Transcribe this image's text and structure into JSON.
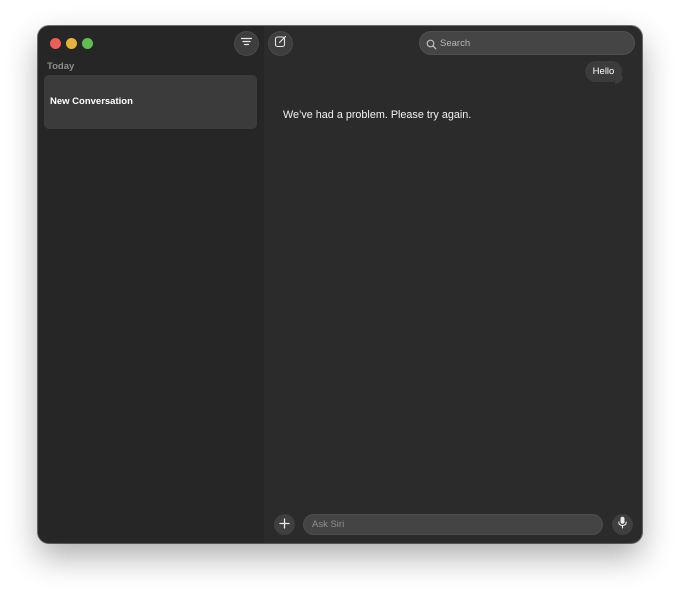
{
  "window": {
    "controls": [
      "close",
      "minimize",
      "zoom"
    ],
    "colors": {
      "close": "#ec5f57",
      "minimize": "#e3b33d",
      "zoom": "#5fbe4f"
    }
  },
  "toolbar": {
    "filter_icon": "filter-lines-icon",
    "compose_icon": "compose-icon"
  },
  "sidebar": {
    "section_label": "Today",
    "conversations": [
      {
        "title": "New Conversation",
        "selected": true
      }
    ]
  },
  "search": {
    "placeholder": "Search",
    "value": ""
  },
  "chat": {
    "messages": [
      {
        "role": "user",
        "text": "Hello"
      },
      {
        "role": "assistant",
        "text": "We’ve had a problem. Please try again."
      }
    ]
  },
  "composer": {
    "placeholder": "Ask Siri",
    "value": "",
    "add_icon": "plus-icon",
    "mic_icon": "microphone-icon"
  }
}
